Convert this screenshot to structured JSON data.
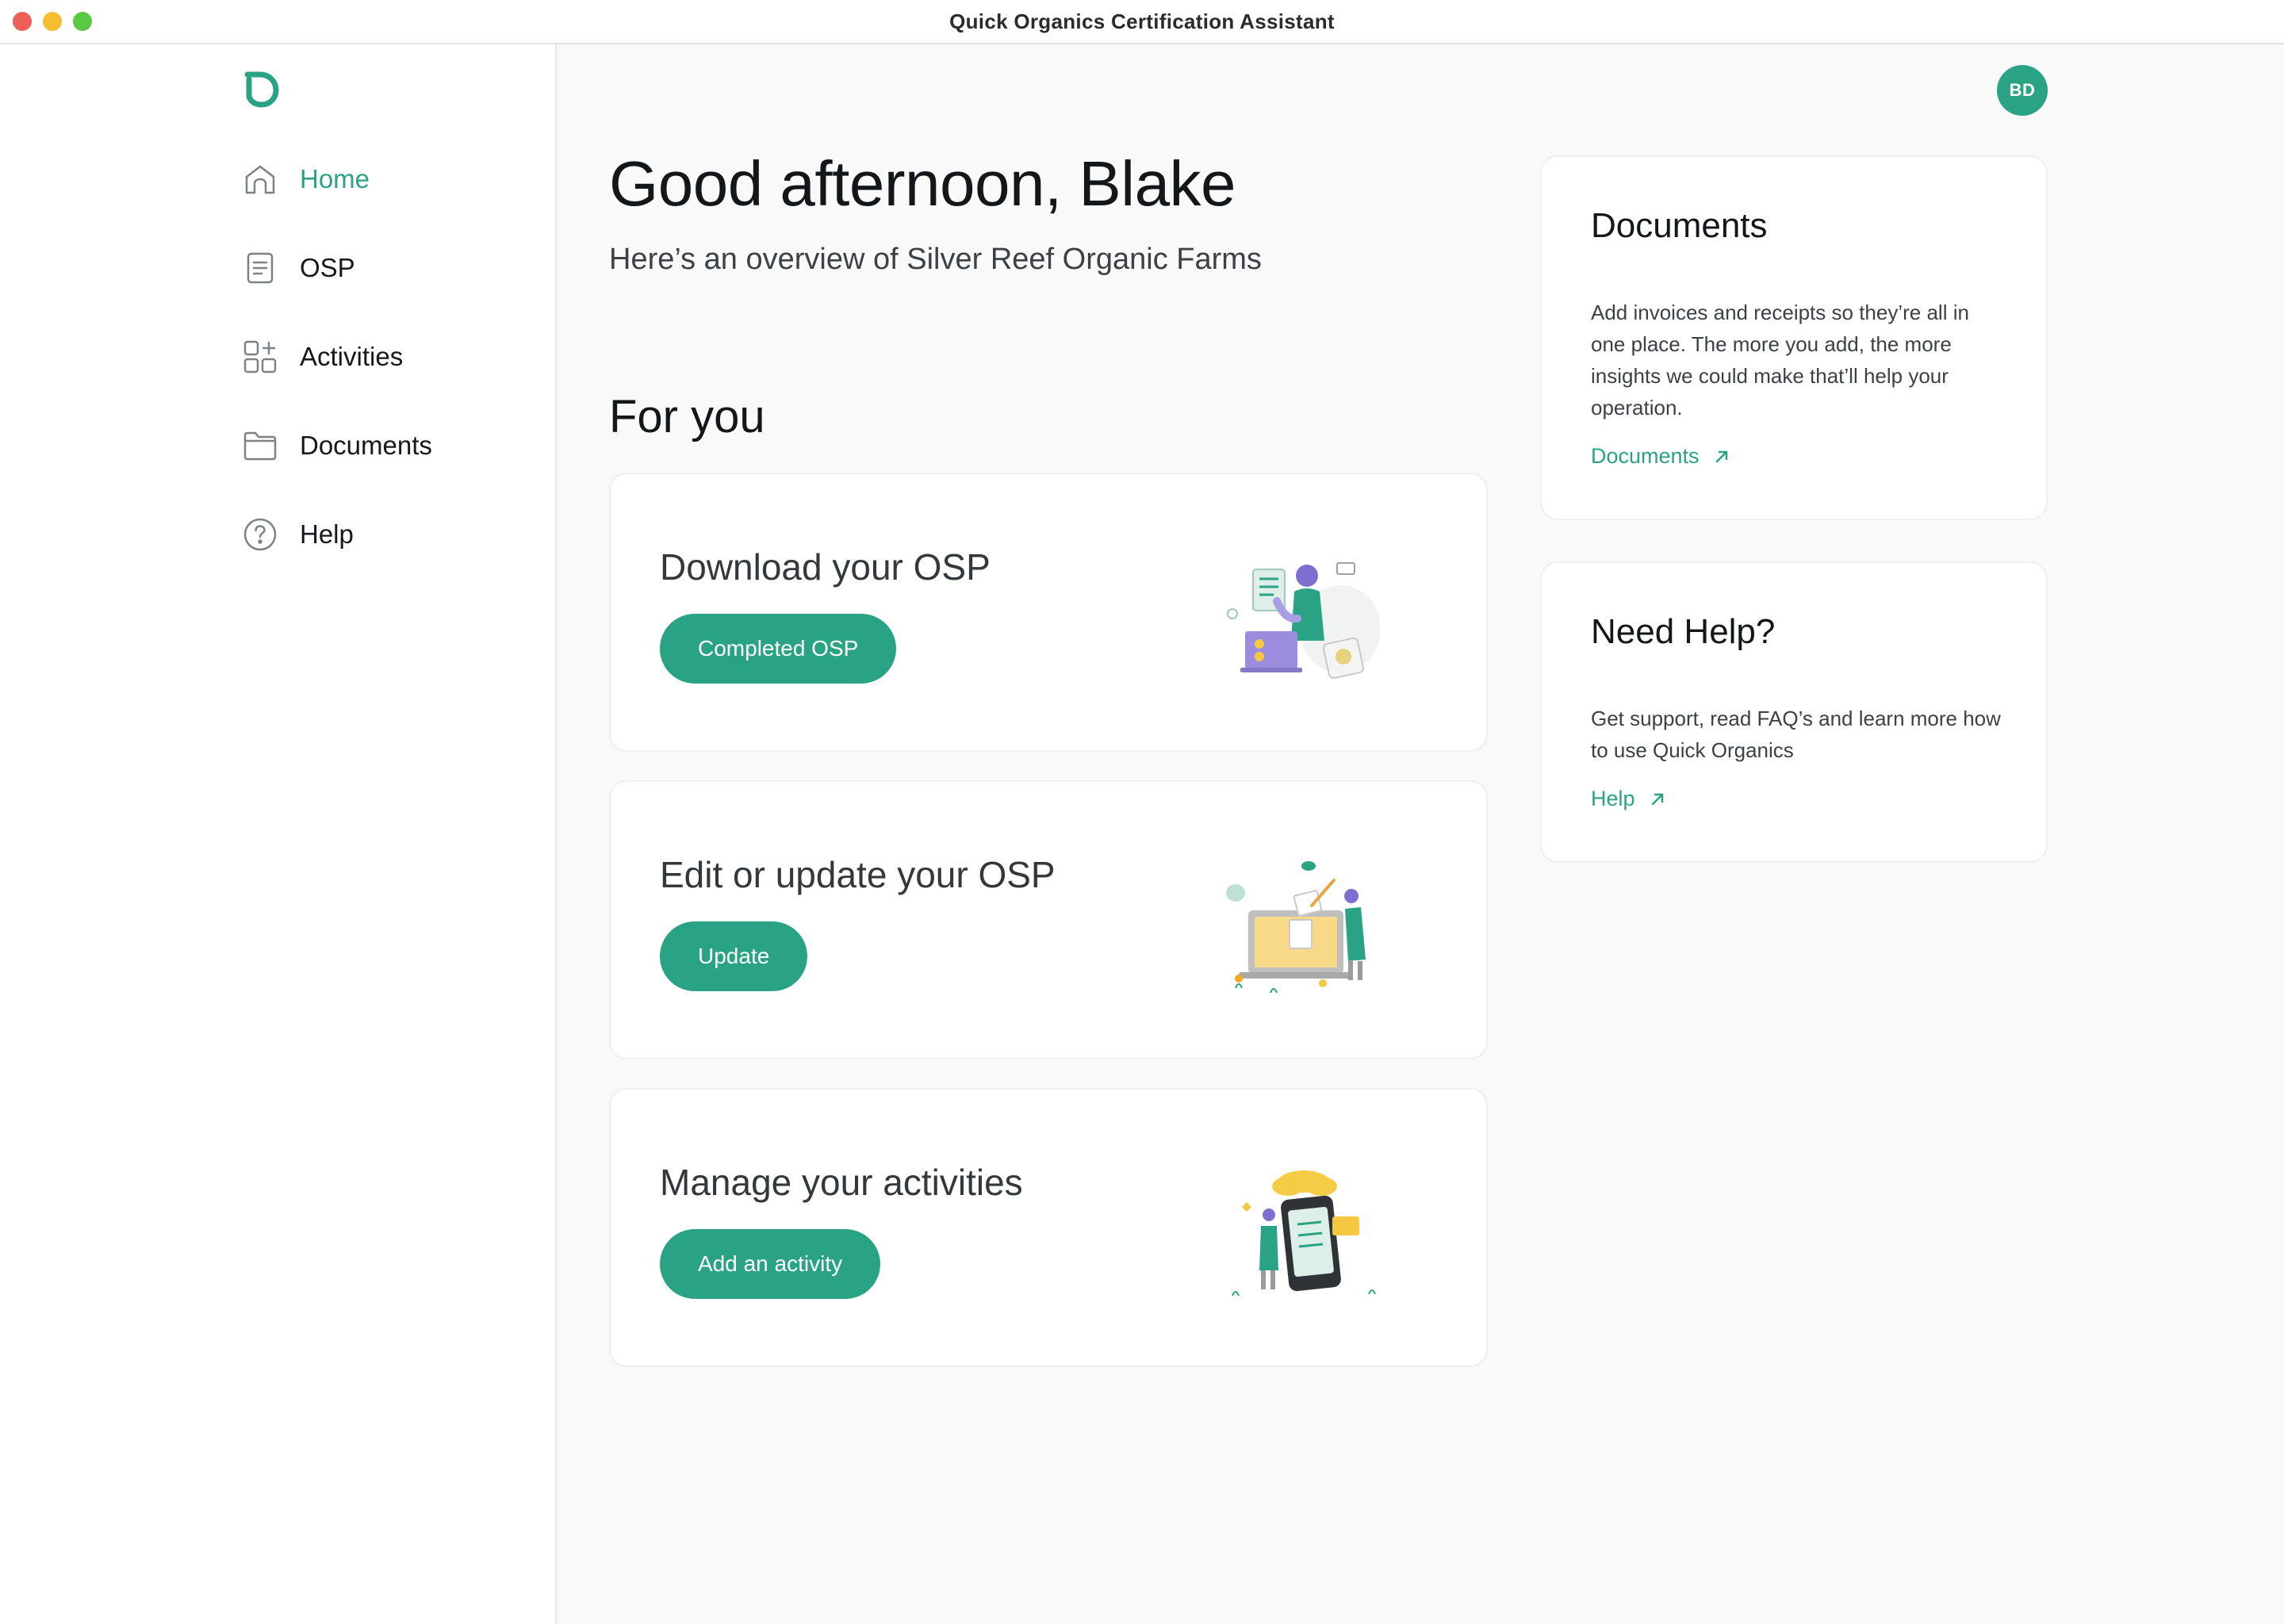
{
  "window": {
    "title": "Quick Organics Certification Assistant"
  },
  "sidebar": {
    "items": [
      {
        "label": "Home",
        "icon": "home-icon",
        "active": true
      },
      {
        "label": "OSP",
        "icon": "document-icon",
        "active": false
      },
      {
        "label": "Activities",
        "icon": "activities-grid-icon",
        "active": false
      },
      {
        "label": "Documents",
        "icon": "folder-icon",
        "active": false
      },
      {
        "label": "Help",
        "icon": "help-circle-icon",
        "active": false
      }
    ]
  },
  "header": {
    "avatar_initials": "BD"
  },
  "main": {
    "greeting": "Good afternoon, Blake",
    "subtitle": "Here’s an overview of Silver Reef Organic Farms",
    "section_title": "For you",
    "cards": [
      {
        "title": "Download your OSP",
        "button": "Completed OSP"
      },
      {
        "title": "Edit or update your OSP",
        "button": "Update"
      },
      {
        "title": "Manage your activities",
        "button": "Add an activity"
      }
    ]
  },
  "side": {
    "documents": {
      "title": "Documents",
      "body": "Add invoices and receipts so they’re all in one place. The more you add, the more insights we could make that’ll help your operation.",
      "link": "Documents"
    },
    "help": {
      "title": "Need Help?",
      "body": "Get support, read FAQ’s and learn more how to use Quick Organics",
      "link": "Help"
    }
  },
  "colors": {
    "accent": "#2aa384",
    "background": "#f9f9f9",
    "card": "#ffffff"
  }
}
